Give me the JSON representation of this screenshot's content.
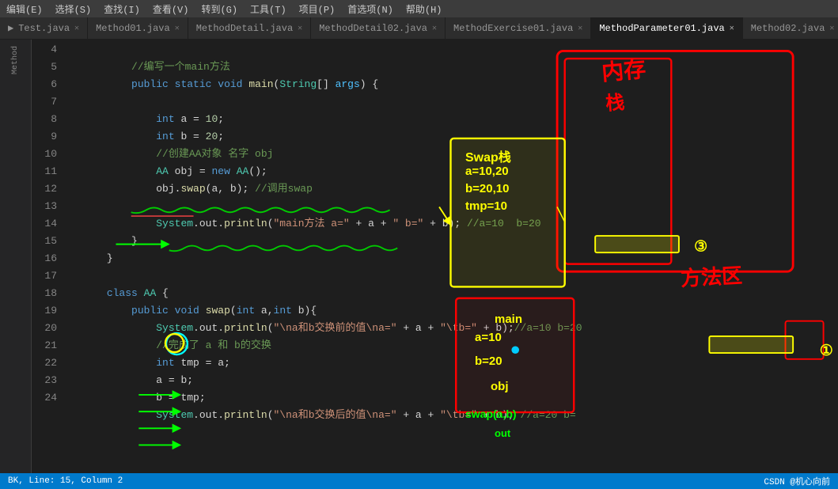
{
  "menubar": {
    "items": [
      "编辑(E)",
      "选择(S)",
      "查找(I)",
      "查看(V)",
      "转到(G)",
      "工具(T)",
      "项目(P)",
      "首选项(N)",
      "帮助(H)"
    ]
  },
  "tabs": [
    {
      "label": "Test.java",
      "active": false,
      "dirty": false
    },
    {
      "label": "Method01.java",
      "active": false,
      "dirty": false
    },
    {
      "label": "MethodDetail.java",
      "active": false,
      "dirty": false
    },
    {
      "label": "MethodDetail02.java",
      "active": false,
      "dirty": false
    },
    {
      "label": "MethodExercise01.java",
      "active": false,
      "dirty": false
    },
    {
      "label": "MethodParameter01.java",
      "active": true,
      "dirty": false
    },
    {
      "label": "Method02.java",
      "active": false,
      "dirty": false
    }
  ],
  "code_lines": [
    {
      "num": 4,
      "content": "    //编写一个main方法"
    },
    {
      "num": 5,
      "content": "    public static void main(String[] args) {"
    },
    {
      "num": 6,
      "content": ""
    },
    {
      "num": 7,
      "content": "        int a = 10;"
    },
    {
      "num": 8,
      "content": "        int b = 20;"
    },
    {
      "num": 9,
      "content": "        //创建AA对象 名字 obj"
    },
    {
      "num": 10,
      "content": "        AA obj = new AA();"
    },
    {
      "num": 11,
      "content": "        obj.swap(a, b); //调用swap"
    },
    {
      "num": 12,
      "content": ""
    },
    {
      "num": 13,
      "content": "        System.out.println(\"main方法 a=\" + a + \" b=\" + b); //a=10 b=20"
    },
    {
      "num": 14,
      "content": "    }"
    },
    {
      "num": 15,
      "content": "}"
    },
    {
      "num": 16,
      "content": ""
    },
    {
      "num": 17,
      "content": "class AA {"
    },
    {
      "num": 18,
      "content": "    public void swap(int a,int b){"
    },
    {
      "num": 19,
      "content": "        System.out.println(\"\\na和b交换前的值\\na=\" + a + \"\\tb=\" + b); //a=10 b=20"
    },
    {
      "num": 20,
      "content": "        //完成了 a 和 b的交换"
    },
    {
      "num": 21,
      "content": "        int tmp = a;"
    },
    {
      "num": 22,
      "content": "        a = b;"
    },
    {
      "num": 23,
      "content": "        b = tmp;"
    },
    {
      "num": 24,
      "content": "        System.out.println(\"\\na和b交换后的值\\na=\" + a + \"\\tb=\" + b); //a=20 b="
    }
  ],
  "status": {
    "left": "BK, Line: 15, Column 2",
    "right": "CSDN @机心向前"
  },
  "annotations": {
    "neicun": "内存",
    "zhan": "栈",
    "swap_stack_label": "Swap栈",
    "swap_a": "a=10,20",
    "swap_b": "b=20,10",
    "swap_tmp": "tmp=10",
    "main_label": "main",
    "main_a": "a=10",
    "main_b": "b=20",
    "obj_label": "obj",
    "swap_call": "swap(a,b)",
    "out_label": "out",
    "fangzhan_label": "方法区",
    "number3": "3",
    "number1": "1",
    "number_circle": "0"
  }
}
